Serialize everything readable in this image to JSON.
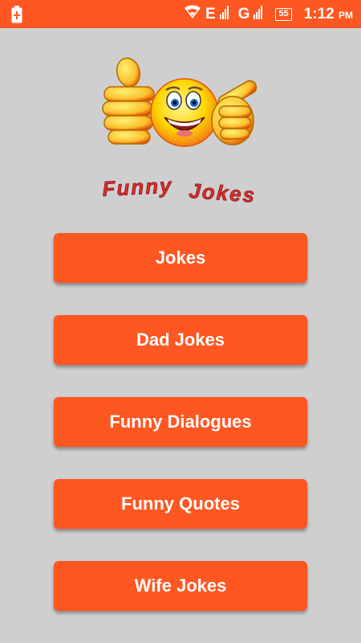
{
  "status_bar": {
    "network_letter_1": "E",
    "network_letter_2": "G",
    "battery_level": "55",
    "time": "1:12",
    "time_suffix": "PM",
    "accent_color": "#ff5722"
  },
  "app": {
    "title_word_1": "Funny",
    "title_word_2": "Jokes",
    "title_color": "#d32f2f",
    "logo_icon": "smiley-thumbs-up-icon"
  },
  "menu": {
    "button_1": "Jokes",
    "button_2": "Dad Jokes",
    "button_3": "Funny Dialogues",
    "button_4": "Funny Quotes",
    "button_5": "Wife Jokes"
  }
}
